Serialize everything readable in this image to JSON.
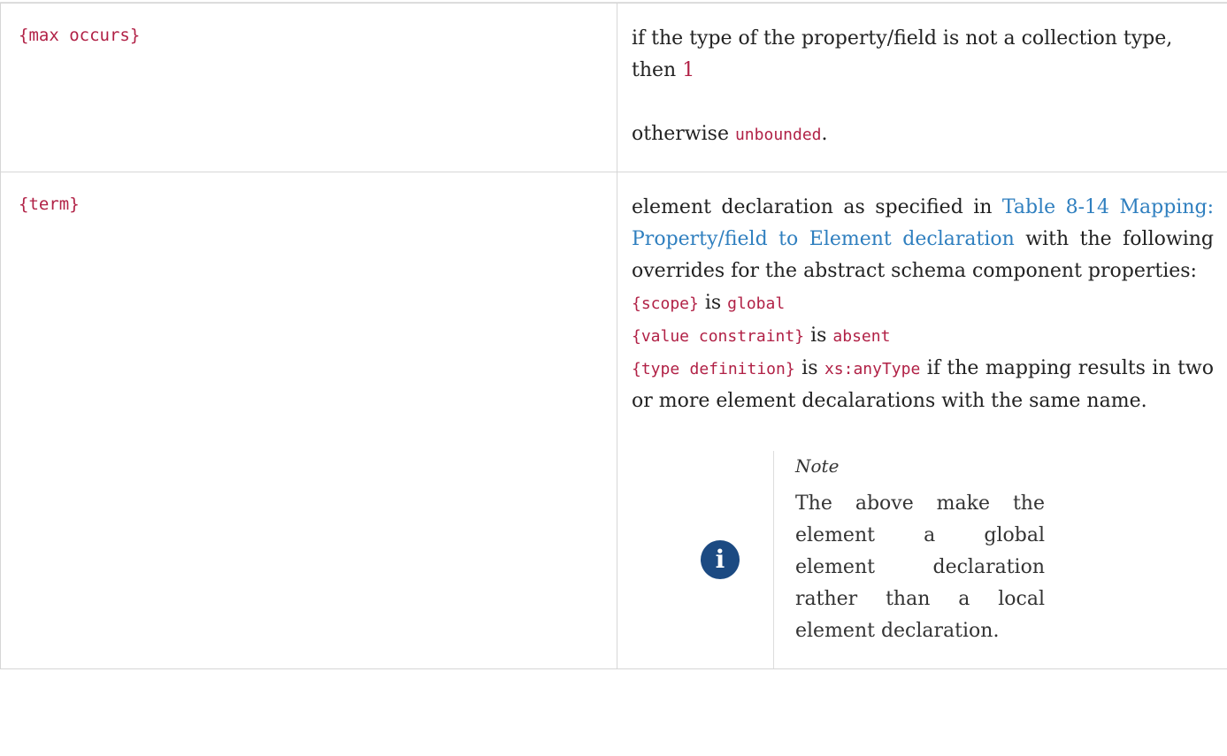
{
  "rows": [
    {
      "property": "{max occurs}",
      "value": {
        "line1_prefix": "if the type of the property/field is not a collection type, then ",
        "line1_number": "1",
        "line2_prefix": "otherwise ",
        "line2_code": "unbounded",
        "line2_suffix": "."
      }
    },
    {
      "property": "{term}",
      "value": {
        "intro_prefix": "element declaration as specified in ",
        "intro_link": "Table 8-14 Mapping: Property/field to Element declaration",
        "intro_suffix": " with the following overrides for the abstract schema component properties:",
        "override1_code": "{scope}",
        "override1_is": " is ",
        "override1_value": "global",
        "override2_code": "{value constraint}",
        "override2_is": " is ",
        "override2_value": "absent",
        "override3_code": "{type definition}",
        "override3_is": " is ",
        "override3_value": "xs:anyType",
        "override3_suffix": " if the mapping results in two or more element decalarations with the same name.",
        "note": {
          "icon": "info-icon",
          "title": "Note",
          "text": "The above make the element a global element declaration rather than a local element declaration."
        }
      }
    }
  ],
  "colors": {
    "code": "#b12146",
    "link": "#2f7fbf",
    "icon": "#1c4a82"
  }
}
